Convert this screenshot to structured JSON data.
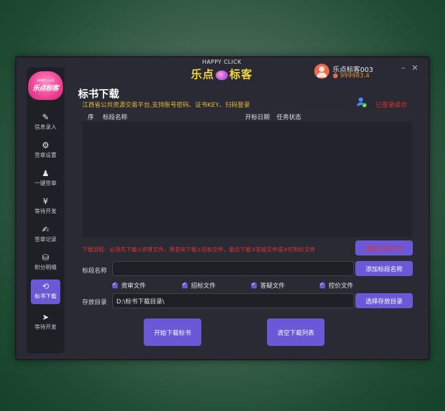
{
  "brand": {
    "en": "HAPPY CLICK",
    "cn_left": "乐点",
    "cn_right": "标客"
  },
  "logo": {
    "small": "HAPPY CLICK",
    "large": "乐点标客"
  },
  "user": {
    "name": "乐点标客003",
    "points": "999983.4"
  },
  "window_controls": {
    "minimize": "–",
    "close": "✕"
  },
  "sidebar": {
    "items": [
      {
        "label": "信息录入",
        "icon": "✎"
      },
      {
        "label": "签章设置",
        "icon": "⚙"
      },
      {
        "label": "一键签章",
        "icon": "♟"
      },
      {
        "label": "等待开发",
        "icon": "¥"
      },
      {
        "label": "签章记录",
        "icon": "✍"
      },
      {
        "label": "积分明细",
        "icon": "⛁"
      },
      {
        "label": "标书下载",
        "icon": "⟲"
      },
      {
        "label": "等待开发",
        "icon": "➤"
      }
    ]
  },
  "page": {
    "title": "标书下载",
    "platform": "江西省公共资源交易平台,支持账号密码、证书KEY、扫码登录",
    "login_status": "已登录成功"
  },
  "table": {
    "headers": [
      "序",
      "标段名称",
      "开标日期",
      "任务状态"
    ],
    "rows": []
  },
  "process_note": "下载流程：必须先下载①资审文件，再查询下载②招标文件，最后下载③答疑文件或④控制价文件",
  "buttons": {
    "login_platform": "登录交易平台",
    "add_section": "添加标段名称",
    "choose_dir": "选择存放目录",
    "start": "开始下载标书",
    "clear": "清空下载列表"
  },
  "form": {
    "section_label": "标段名称",
    "section_value": "",
    "dir_label": "存放目录",
    "dir_value": "D:\\标书下载目录\\"
  },
  "checkboxes": [
    "资审文件",
    "招标文件",
    "答疑文件",
    "控价文件"
  ]
}
